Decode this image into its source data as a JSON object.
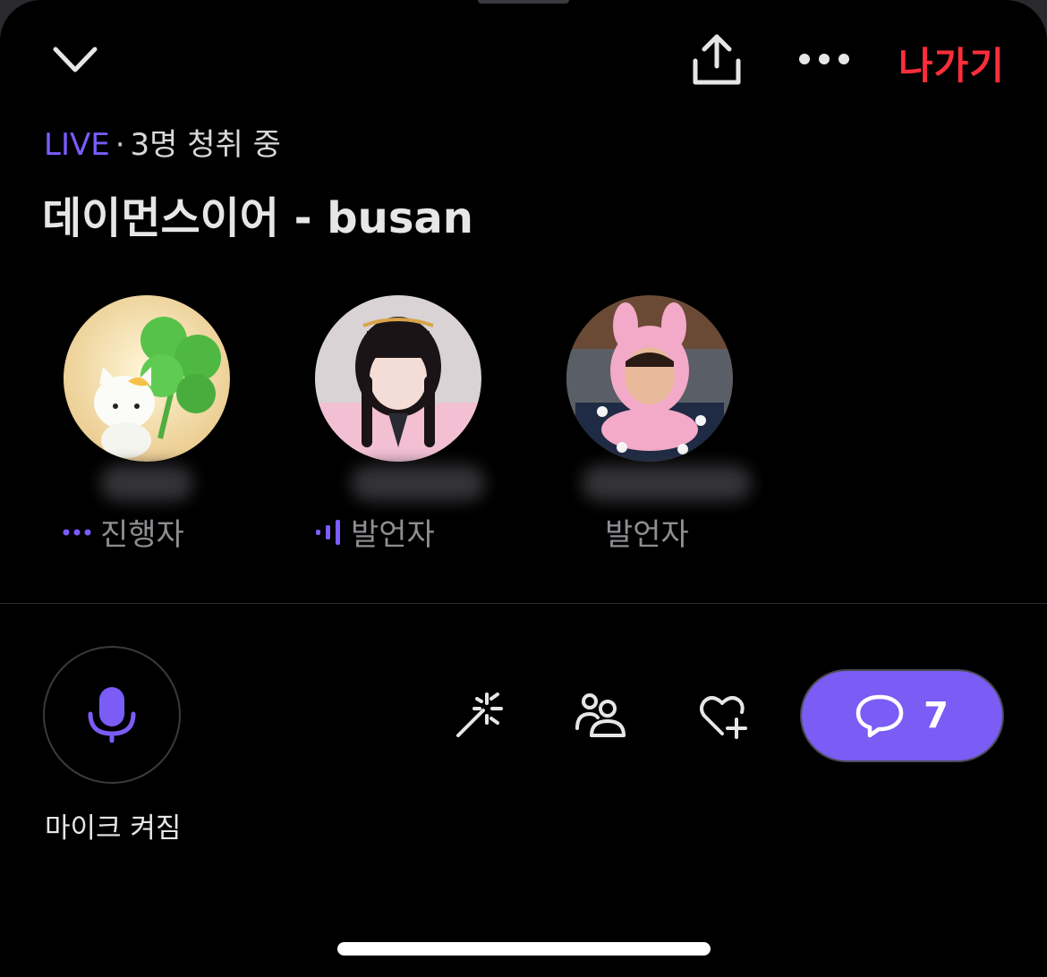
{
  "header": {
    "leave_label": "나가기"
  },
  "room": {
    "live_label": "LIVE",
    "listeners": "3명 청취 중",
    "title": "데이먼스이어 - busan"
  },
  "participants": [
    {
      "role": "진행자"
    },
    {
      "role": "발언자"
    },
    {
      "role": "발언자"
    }
  ],
  "controls": {
    "mic_label": "마이크 켜짐",
    "chat_count": "7"
  },
  "colors": {
    "accent": "#7b5cf5",
    "leave": "#ff2d3a",
    "background": "#000000"
  }
}
